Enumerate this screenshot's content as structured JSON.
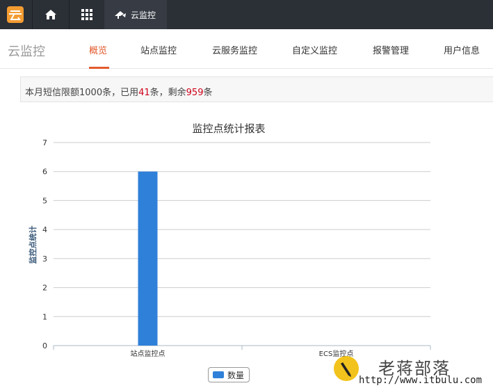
{
  "topbar": {
    "product_label": "云监控",
    "icons": [
      "logo-icon",
      "home-icon",
      "grid-icon",
      "cloud-monitor-icon"
    ],
    "accent_color": "#f39c32"
  },
  "nav": {
    "brand": "云监控",
    "items": [
      {
        "label": "概览",
        "active": true
      },
      {
        "label": "站点监控",
        "active": false
      },
      {
        "label": "云服务监控",
        "active": false
      },
      {
        "label": "自定义监控",
        "active": false
      },
      {
        "label": "报警管理",
        "active": false
      },
      {
        "label": "用户信息",
        "active": false
      }
    ],
    "active_color": "#e25a2e"
  },
  "notice": {
    "prefix": "本月短信限额1000条，已用",
    "used": "41",
    "middle": "条，剩余",
    "remaining": "959",
    "suffix": "条"
  },
  "chart_data": {
    "type": "bar",
    "title": "监控点统计报表",
    "xlabel": "",
    "ylabel": "监控点统计",
    "categories": [
      "站点监控点",
      "ECS监控点"
    ],
    "series": [
      {
        "name": "数量",
        "values": [
          6,
          0
        ],
        "color": "#2f80d9"
      }
    ],
    "ylim": [
      0,
      7
    ],
    "yticks": [
      0,
      1,
      2,
      3,
      4,
      5,
      6,
      7
    ],
    "grid": true,
    "legend": "bottom-center"
  },
  "watermark": {
    "title": "老蒋部落",
    "url": "http://www.itbulu.com"
  }
}
